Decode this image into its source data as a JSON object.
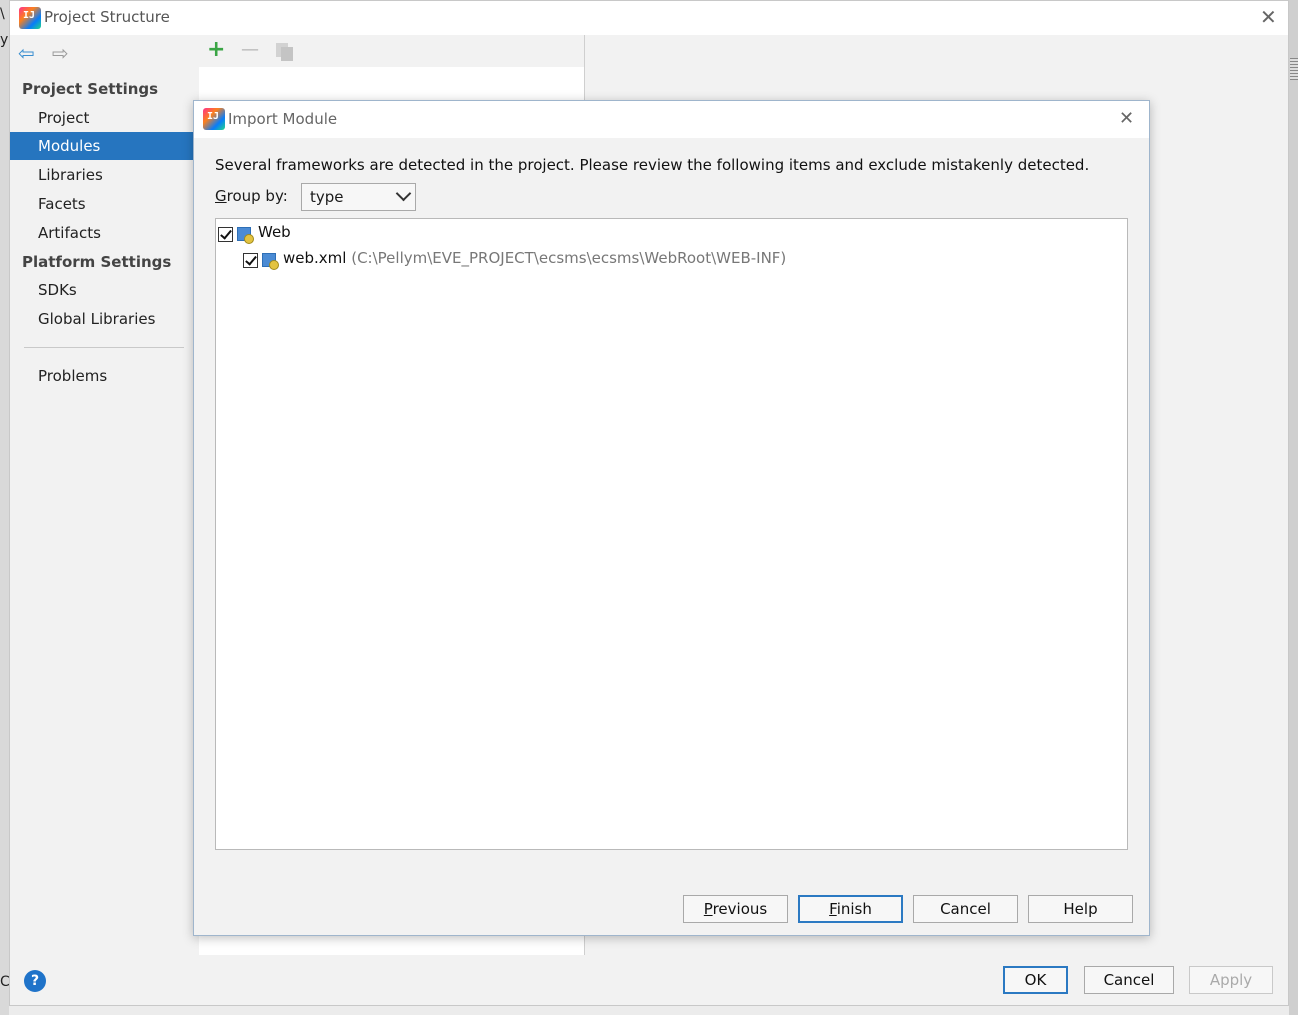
{
  "window": {
    "title": "Project Structure"
  },
  "left_edge_fragments": [
    "\\",
    "y",
    "C"
  ],
  "sidebar": {
    "project_settings_header": "Project Settings",
    "project_items": [
      {
        "label": "Project",
        "selected": false
      },
      {
        "label": "Modules",
        "selected": true
      },
      {
        "label": "Libraries",
        "selected": false
      },
      {
        "label": "Facets",
        "selected": false
      },
      {
        "label": "Artifacts",
        "selected": false
      }
    ],
    "platform_settings_header": "Platform Settings",
    "platform_items": [
      {
        "label": "SDKs"
      },
      {
        "label": "Global Libraries"
      }
    ],
    "problems_label": "Problems",
    "help_glyph": "?"
  },
  "toolbar": {
    "add_glyph": "+",
    "remove_glyph": "—"
  },
  "footer": {
    "ok_label": "OK",
    "cancel_label": "Cancel",
    "apply_label": "Apply"
  },
  "dialog": {
    "title": "Import Module",
    "message": "Several frameworks are detected in the project. Please review the following items and exclude mistakenly detected.",
    "group_by": {
      "mnemonic": "G",
      "rest": "roup by:",
      "value": "type"
    },
    "tree": {
      "group_label": "Web",
      "group_checked": true,
      "child_label": "web.xml",
      "child_path": "(C:\\Pellym\\EVE_PROJECT\\ecsms\\ecsms\\WebRoot\\WEB-INF)",
      "child_checked": true
    },
    "buttons": {
      "previous_mnemonic": "P",
      "previous_rest": "revious",
      "finish_mnemonic": "F",
      "finish_rest": "inish",
      "cancel_label": "Cancel",
      "help_label": "Help"
    }
  },
  "colors": {
    "selection": "#2675bf",
    "add_icon": "#3aa545",
    "nav_arrow": "#3b8fd0",
    "dialog_default_border": "#2b79c2"
  },
  "icons": [
    "intellij-idea-icon",
    "back-arrow-icon",
    "forward-arrow-icon",
    "add-icon",
    "remove-icon",
    "copy-icon",
    "close-icon",
    "web-facet-icon",
    "checkbox-checked-icon",
    "help-icon",
    "chevron-down-icon"
  ]
}
